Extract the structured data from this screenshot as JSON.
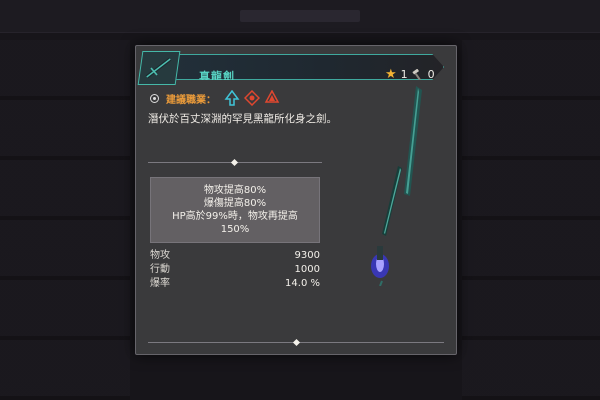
{
  "background_title": "",
  "card": {
    "name": "真龍劍",
    "star_count": "1",
    "hammer_count": "0",
    "recommended_label": "建議職業：",
    "recommended_jobs": [
      "job-icon-arrow",
      "job-icon-helmet",
      "job-icon-flame"
    ],
    "description": "潛伏於百丈深淵的罕見黑龍所化身之劍。",
    "effects": [
      "物攻提高80%",
      "爆傷提高80%",
      "HP高於99%時，物攻再提高",
      "150%"
    ],
    "stats": [
      {
        "name": "物攻",
        "value": "9300"
      },
      {
        "name": "行動",
        "value": "1000"
      },
      {
        "name": "爆率",
        "value": "14.0 %"
      }
    ]
  },
  "colors": {
    "accent_teal": "#58d3c3",
    "label_orange": "#e99a3a",
    "star_gold": "#f2b233",
    "job_red": "#e0472f",
    "job_cyan": "#3fc4d8"
  }
}
